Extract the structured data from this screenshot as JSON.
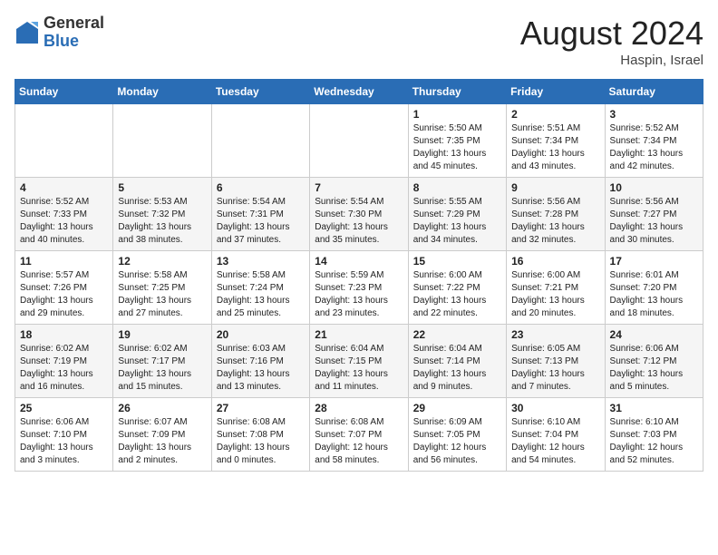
{
  "header": {
    "logo_general": "General",
    "logo_blue": "Blue",
    "month_title": "August 2024",
    "location": "Haspin, Israel"
  },
  "weekdays": [
    "Sunday",
    "Monday",
    "Tuesday",
    "Wednesday",
    "Thursday",
    "Friday",
    "Saturday"
  ],
  "weeks": [
    [
      {
        "day": "",
        "sunrise": "",
        "sunset": "",
        "daylight": ""
      },
      {
        "day": "",
        "sunrise": "",
        "sunset": "",
        "daylight": ""
      },
      {
        "day": "",
        "sunrise": "",
        "sunset": "",
        "daylight": ""
      },
      {
        "day": "",
        "sunrise": "",
        "sunset": "",
        "daylight": ""
      },
      {
        "day": "1",
        "sunrise": "Sunrise: 5:50 AM",
        "sunset": "Sunset: 7:35 PM",
        "daylight": "Daylight: 13 hours and 45 minutes."
      },
      {
        "day": "2",
        "sunrise": "Sunrise: 5:51 AM",
        "sunset": "Sunset: 7:34 PM",
        "daylight": "Daylight: 13 hours and 43 minutes."
      },
      {
        "day": "3",
        "sunrise": "Sunrise: 5:52 AM",
        "sunset": "Sunset: 7:34 PM",
        "daylight": "Daylight: 13 hours and 42 minutes."
      }
    ],
    [
      {
        "day": "4",
        "sunrise": "Sunrise: 5:52 AM",
        "sunset": "Sunset: 7:33 PM",
        "daylight": "Daylight: 13 hours and 40 minutes."
      },
      {
        "day": "5",
        "sunrise": "Sunrise: 5:53 AM",
        "sunset": "Sunset: 7:32 PM",
        "daylight": "Daylight: 13 hours and 38 minutes."
      },
      {
        "day": "6",
        "sunrise": "Sunrise: 5:54 AM",
        "sunset": "Sunset: 7:31 PM",
        "daylight": "Daylight: 13 hours and 37 minutes."
      },
      {
        "day": "7",
        "sunrise": "Sunrise: 5:54 AM",
        "sunset": "Sunset: 7:30 PM",
        "daylight": "Daylight: 13 hours and 35 minutes."
      },
      {
        "day": "8",
        "sunrise": "Sunrise: 5:55 AM",
        "sunset": "Sunset: 7:29 PM",
        "daylight": "Daylight: 13 hours and 34 minutes."
      },
      {
        "day": "9",
        "sunrise": "Sunrise: 5:56 AM",
        "sunset": "Sunset: 7:28 PM",
        "daylight": "Daylight: 13 hours and 32 minutes."
      },
      {
        "day": "10",
        "sunrise": "Sunrise: 5:56 AM",
        "sunset": "Sunset: 7:27 PM",
        "daylight": "Daylight: 13 hours and 30 minutes."
      }
    ],
    [
      {
        "day": "11",
        "sunrise": "Sunrise: 5:57 AM",
        "sunset": "Sunset: 7:26 PM",
        "daylight": "Daylight: 13 hours and 29 minutes."
      },
      {
        "day": "12",
        "sunrise": "Sunrise: 5:58 AM",
        "sunset": "Sunset: 7:25 PM",
        "daylight": "Daylight: 13 hours and 27 minutes."
      },
      {
        "day": "13",
        "sunrise": "Sunrise: 5:58 AM",
        "sunset": "Sunset: 7:24 PM",
        "daylight": "Daylight: 13 hours and 25 minutes."
      },
      {
        "day": "14",
        "sunrise": "Sunrise: 5:59 AM",
        "sunset": "Sunset: 7:23 PM",
        "daylight": "Daylight: 13 hours and 23 minutes."
      },
      {
        "day": "15",
        "sunrise": "Sunrise: 6:00 AM",
        "sunset": "Sunset: 7:22 PM",
        "daylight": "Daylight: 13 hours and 22 minutes."
      },
      {
        "day": "16",
        "sunrise": "Sunrise: 6:00 AM",
        "sunset": "Sunset: 7:21 PM",
        "daylight": "Daylight: 13 hours and 20 minutes."
      },
      {
        "day": "17",
        "sunrise": "Sunrise: 6:01 AM",
        "sunset": "Sunset: 7:20 PM",
        "daylight": "Daylight: 13 hours and 18 minutes."
      }
    ],
    [
      {
        "day": "18",
        "sunrise": "Sunrise: 6:02 AM",
        "sunset": "Sunset: 7:19 PM",
        "daylight": "Daylight: 13 hours and 16 minutes."
      },
      {
        "day": "19",
        "sunrise": "Sunrise: 6:02 AM",
        "sunset": "Sunset: 7:17 PM",
        "daylight": "Daylight: 13 hours and 15 minutes."
      },
      {
        "day": "20",
        "sunrise": "Sunrise: 6:03 AM",
        "sunset": "Sunset: 7:16 PM",
        "daylight": "Daylight: 13 hours and 13 minutes."
      },
      {
        "day": "21",
        "sunrise": "Sunrise: 6:04 AM",
        "sunset": "Sunset: 7:15 PM",
        "daylight": "Daylight: 13 hours and 11 minutes."
      },
      {
        "day": "22",
        "sunrise": "Sunrise: 6:04 AM",
        "sunset": "Sunset: 7:14 PM",
        "daylight": "Daylight: 13 hours and 9 minutes."
      },
      {
        "day": "23",
        "sunrise": "Sunrise: 6:05 AM",
        "sunset": "Sunset: 7:13 PM",
        "daylight": "Daylight: 13 hours and 7 minutes."
      },
      {
        "day": "24",
        "sunrise": "Sunrise: 6:06 AM",
        "sunset": "Sunset: 7:12 PM",
        "daylight": "Daylight: 13 hours and 5 minutes."
      }
    ],
    [
      {
        "day": "25",
        "sunrise": "Sunrise: 6:06 AM",
        "sunset": "Sunset: 7:10 PM",
        "daylight": "Daylight: 13 hours and 3 minutes."
      },
      {
        "day": "26",
        "sunrise": "Sunrise: 6:07 AM",
        "sunset": "Sunset: 7:09 PM",
        "daylight": "Daylight: 13 hours and 2 minutes."
      },
      {
        "day": "27",
        "sunrise": "Sunrise: 6:08 AM",
        "sunset": "Sunset: 7:08 PM",
        "daylight": "Daylight: 13 hours and 0 minutes."
      },
      {
        "day": "28",
        "sunrise": "Sunrise: 6:08 AM",
        "sunset": "Sunset: 7:07 PM",
        "daylight": "Daylight: 12 hours and 58 minutes."
      },
      {
        "day": "29",
        "sunrise": "Sunrise: 6:09 AM",
        "sunset": "Sunset: 7:05 PM",
        "daylight": "Daylight: 12 hours and 56 minutes."
      },
      {
        "day": "30",
        "sunrise": "Sunrise: 6:10 AM",
        "sunset": "Sunset: 7:04 PM",
        "daylight": "Daylight: 12 hours and 54 minutes."
      },
      {
        "day": "31",
        "sunrise": "Sunrise: 6:10 AM",
        "sunset": "Sunset: 7:03 PM",
        "daylight": "Daylight: 12 hours and 52 minutes."
      }
    ]
  ]
}
